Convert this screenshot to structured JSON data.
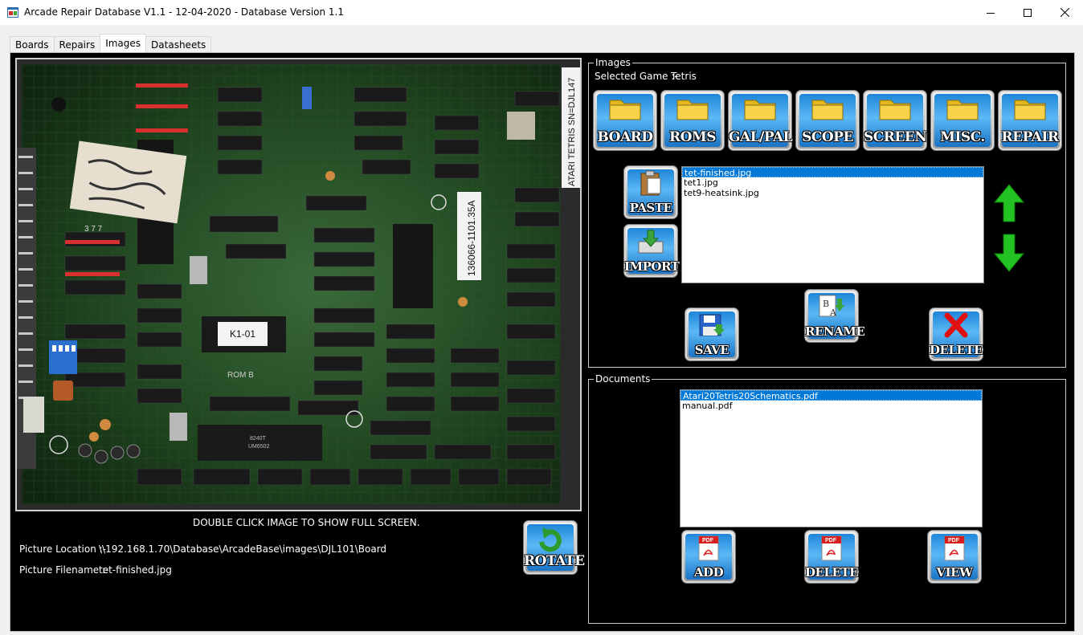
{
  "window": {
    "title": "Arcade Repair Database V1.1 - 12-04-2020 - Database Version 1.1"
  },
  "tabs": [
    {
      "label": "Boards"
    },
    {
      "label": "Repairs"
    },
    {
      "label": "Images"
    },
    {
      "label": "Datasheets"
    }
  ],
  "active_tab": "Images",
  "preview": {
    "caption": "DOUBLE CLICK IMAGE TO SHOW FULL SCREEN.",
    "board_labels": {
      "serial": "ATARI TETRIS SN=DJL147",
      "part_number": "136066-1101.35A",
      "chip": "K1-01",
      "rom": "ROM B",
      "cpu_top": "8240T",
      "cpu_bottom": "UM6502",
      "sticker": "3 7 7"
    }
  },
  "picture_info": {
    "location_label": "Picture Location :-",
    "location_value": "\\\\192.168.1.70\\Database\\ArcadeBase\\images\\DJL101\\Board",
    "filename_label": "Picture Filename :-",
    "filename_value": "tet-finished.jpg"
  },
  "rotate_button": {
    "label": "ROTATE",
    "icon": "rotate-icon"
  },
  "images_group": {
    "title": "Images",
    "selected_game_label": "Selected Game :-",
    "selected_game_value": "Tetris",
    "category_buttons": [
      {
        "label": "BOARD"
      },
      {
        "label": "ROMS"
      },
      {
        "label": "GAL/PAL"
      },
      {
        "label": "SCOPE"
      },
      {
        "label": "SCREEN"
      },
      {
        "label": "MISC."
      },
      {
        "label": "REPAIR"
      }
    ],
    "paste_label": "PASTE",
    "import_label": "IMPORT",
    "files": [
      {
        "name": "tet-finished.jpg",
        "selected": true
      },
      {
        "name": "tet1.jpg",
        "selected": false
      },
      {
        "name": "tet9-heatsink.jpg",
        "selected": false
      }
    ],
    "save_label": "SAVE",
    "rename_label": "RENAME",
    "delete_label": "DELETE"
  },
  "documents_group": {
    "title": "Documents",
    "files": [
      {
        "name": "Atari20Tetris20Schematics.pdf",
        "selected": true
      },
      {
        "name": "manual.pdf",
        "selected": false
      }
    ],
    "add_label": "ADD",
    "delete_label": "DELETE",
    "view_label": "VIEW",
    "pdf_icon_text": "PDF"
  },
  "colors": {
    "selection": "#0078d7",
    "button_blue": "#3aa0ec",
    "arrow_green": "#22c322",
    "delete_red": "#e01010"
  }
}
